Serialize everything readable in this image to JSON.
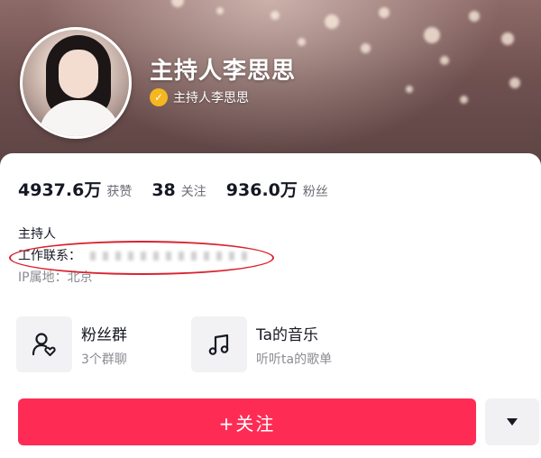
{
  "profile": {
    "name": "主持人李思思",
    "verified_label": "主持人李思思"
  },
  "stats": [
    {
      "value": "4937.6万",
      "label": "获赞"
    },
    {
      "value": "38",
      "label": "关注"
    },
    {
      "value": "936.0万",
      "label": "粉丝"
    }
  ],
  "bio": {
    "line1": "主持人",
    "contact_label": "工作联系：",
    "ip_label": "IP属地：北京"
  },
  "features": [
    {
      "title": "粉丝群",
      "subtitle": "3个群聊",
      "icon": "fan-group-icon"
    },
    {
      "title": "Ta的音乐",
      "subtitle": "听听ta的歌单",
      "icon": "music-note-icon"
    }
  ],
  "actions": {
    "follow_label": "+关注",
    "more_icon": "triangle-down-icon"
  },
  "colors": {
    "follow_button": "#fe2c55",
    "verify_badge": "#f5b71f",
    "highlight_oval": "#d9232e"
  }
}
